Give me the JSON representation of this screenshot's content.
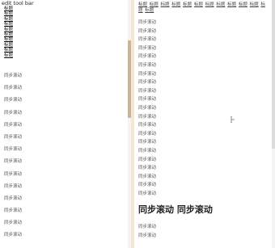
{
  "toolbar": {
    "title": "edit tool bar"
  },
  "left": {
    "links": [
      "标题",
      "标题",
      "标题",
      "标题",
      "标题",
      "标题",
      "标题",
      "标题",
      "标题",
      "标题"
    ],
    "lines": [
      "同步滚动",
      "同步滚动",
      "同步滚动",
      "同步滚动",
      "同步滚动",
      "同步滚动",
      "同步滚动",
      "同步滚动",
      "同步滚动",
      "同步滚动",
      "同步滚动",
      "同步滚动",
      "同步滚动",
      "同步滚动"
    ]
  },
  "right": {
    "links": [
      "标题",
      "标题",
      "标题",
      "标题",
      "标题",
      "标题",
      "标题",
      "标题",
      "标题",
      "标题",
      "标题",
      "标题",
      "标题"
    ],
    "lines": [
      "同步滚动",
      "同步滚动",
      "同步滚动",
      "同步滚动",
      "同步滚动",
      "同步滚动",
      "同步滚动",
      "同步滚动",
      "同步滚动",
      "同步滚动",
      "同步滚动",
      "同步滚动",
      "同步滚动",
      "同步滚动",
      "同步滚动",
      "同步滚动",
      "同步滚动",
      "同步滚动",
      "同步滚动",
      "同步滚动",
      "同步滚动"
    ],
    "heading": "同步滚动 同步滚动",
    "lines_after": [
      "同步滚动",
      "同步滚动"
    ]
  }
}
